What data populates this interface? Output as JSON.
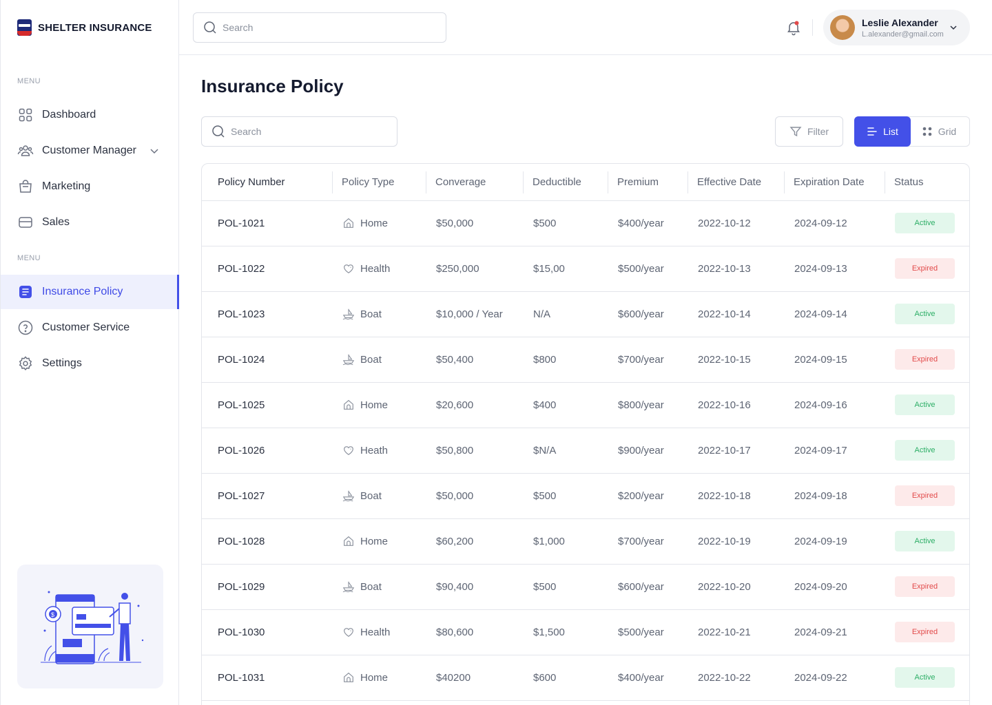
{
  "brand": {
    "name": "SHELTER INSURANCE"
  },
  "sidebar": {
    "menu_label_1": "MENU",
    "menu_label_2": "MENU",
    "items": [
      {
        "label": "Dashboard",
        "icon": "dashboard-grid-icon"
      },
      {
        "label": "Customer Manager",
        "icon": "users-icon"
      },
      {
        "label": "Marketing",
        "icon": "shopping-bag-icon"
      },
      {
        "label": "Sales",
        "icon": "card-icon"
      },
      {
        "label": "Insurance Policy",
        "icon": "document-icon",
        "active": true
      },
      {
        "label": "Customer Service",
        "icon": "question-circle-icon"
      },
      {
        "label": "Settings",
        "icon": "gear-icon"
      }
    ]
  },
  "topbar": {
    "search_placeholder": "Search",
    "user": {
      "name": "Leslie Alexander",
      "email": "L.alexander@gmail.com"
    }
  },
  "main": {
    "title": "Insurance Policy",
    "search_placeholder": "Search",
    "filter_label": "Filter",
    "view_list_label": "List",
    "view_grid_label": "Grid"
  },
  "table": {
    "headers": [
      "Policy Number",
      "Policy Type",
      "Converage",
      "Deductible",
      "Premium",
      "Effective Date",
      "Expiration Date",
      "Status"
    ],
    "rows": [
      {
        "number": "POL-1021",
        "type": "Home",
        "icon": "home-icon",
        "coverage": "$50,000",
        "deductible": "$500",
        "premium": "$400/year",
        "effective": "2022-10-12",
        "expiration": "2024-09-12",
        "status": "Active"
      },
      {
        "number": "POL-1022",
        "type": "Health",
        "icon": "heart-icon",
        "coverage": "$250,000",
        "deductible": "$15,00",
        "premium": "$500/year",
        "effective": "2022-10-13",
        "expiration": "2024-09-13",
        "status": "Expired"
      },
      {
        "number": "POL-1023",
        "type": "Boat",
        "icon": "boat-icon",
        "coverage": "$10,000 / Year",
        "deductible": "N/A",
        "premium": "$600/year",
        "effective": "2022-10-14",
        "expiration": "2024-09-14",
        "status": "Active"
      },
      {
        "number": "POL-1024",
        "type": "Boat",
        "icon": "boat-icon",
        "coverage": "$50,400",
        "deductible": "$800",
        "premium": "$700/year",
        "effective": "2022-10-15",
        "expiration": "2024-09-15",
        "status": "Expired"
      },
      {
        "number": "POL-1025",
        "type": "Home",
        "icon": "home-icon",
        "coverage": "$20,600",
        "deductible": "$400",
        "premium": "$800/year",
        "effective": "2022-10-16",
        "expiration": "2024-09-16",
        "status": "Active"
      },
      {
        "number": "POL-1026",
        "type": "Heath",
        "icon": "heart-icon",
        "coverage": "$50,800",
        "deductible": "$N/A",
        "premium": "$900/year",
        "effective": "2022-10-17",
        "expiration": "2024-09-17",
        "status": "Active"
      },
      {
        "number": "POL-1027",
        "type": "Boat",
        "icon": "boat-icon",
        "coverage": "$50,000",
        "deductible": "$500",
        "premium": "$200/year",
        "effective": "2022-10-18",
        "expiration": "2024-09-18",
        "status": "Expired"
      },
      {
        "number": "POL-1028",
        "type": "Home",
        "icon": "home-icon",
        "coverage": "$60,200",
        "deductible": "$1,000",
        "premium": "$700/year",
        "effective": "2022-10-19",
        "expiration": "2024-09-19",
        "status": "Active"
      },
      {
        "number": "POL-1029",
        "type": "Boat",
        "icon": "boat-icon",
        "coverage": "$90,400",
        "deductible": "$500",
        "premium": "$600/year",
        "effective": "2022-10-20",
        "expiration": "2024-09-20",
        "status": "Expired"
      },
      {
        "number": "POL-1030",
        "type": "Health",
        "icon": "heart-icon",
        "coverage": "$80,600",
        "deductible": "$1,500",
        "premium": "$500/year",
        "effective": "2022-10-21",
        "expiration": "2024-09-21",
        "status": "Expired"
      },
      {
        "number": "POL-1031",
        "type": "Home",
        "icon": "home-icon",
        "coverage": "$40200",
        "deductible": "$600",
        "premium": "$400/year",
        "effective": "2022-10-22",
        "expiration": "2024-09-22",
        "status": "Active"
      }
    ]
  },
  "colors": {
    "accent": "#4350e8",
    "active_bg": "#e3f7ec",
    "active_text": "#2cae66",
    "expired_bg": "#fdeaea",
    "expired_text": "#e24a4a"
  }
}
